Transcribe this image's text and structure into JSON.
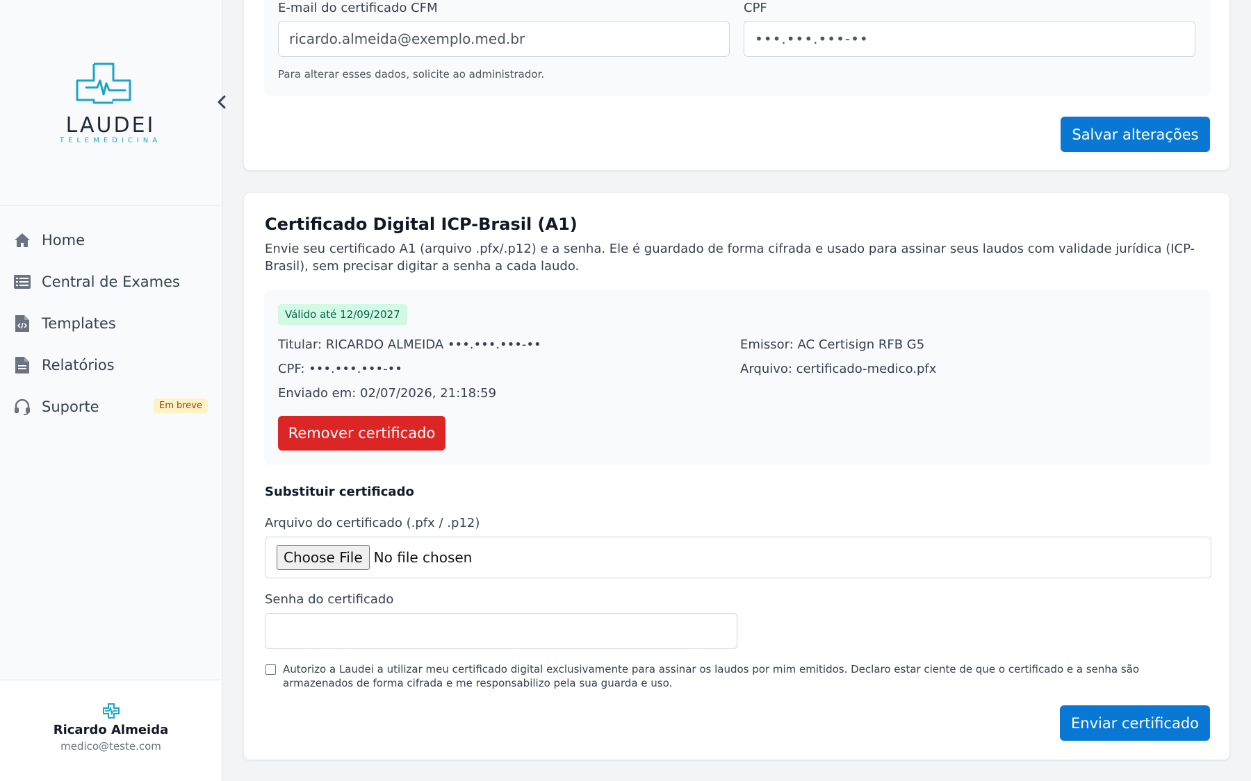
{
  "brand": {
    "name": "LAUDEI",
    "tagline": "TELEMEDICINA",
    "accent": "#1ba6c9"
  },
  "sidebar": {
    "items": [
      {
        "label": "Home",
        "icon": "home-icon"
      },
      {
        "label": "Central de Exames",
        "icon": "list-icon"
      },
      {
        "label": "Templates",
        "icon": "code-file-icon"
      },
      {
        "label": "Relatórios",
        "icon": "document-icon"
      },
      {
        "label": "Suporte",
        "icon": "headset-icon",
        "badge": "Em breve"
      }
    ]
  },
  "user": {
    "name": "Ricardo Almeida",
    "email": "medico@teste.com"
  },
  "profile": {
    "email_label": "E-mail do certificado CFM",
    "email_value": "ricardo.almeida@exemplo.med.br",
    "cpf_label": "CPF",
    "cpf_value": "•••.•••.•••-••",
    "hint": "Para alterar esses dados, solicite ao administrador.",
    "save_label": "Salvar alterações"
  },
  "certificate": {
    "title": "Certificado Digital ICP-Brasil (A1)",
    "description": "Envie seu certificado A1 (arquivo .pfx/.p12) e a senha. Ele é guardado de forma cifrada e usado para assinar seus laudos com validade jurídica (ICP-Brasil), sem precisar digitar a senha a cada laudo.",
    "valid_badge": "Válido até 12/09/2027",
    "holder": "Titular: RICARDO ALMEIDA •••.•••.•••-••",
    "cpf": "CPF: •••.•••.•••-••",
    "sent_at": "Enviado em: 02/07/2026, 21:18:59",
    "issuer": "Emissor: AC Certisign RFB G5",
    "file": "Arquivo: certificado-medico.pfx",
    "remove_label": "Remover certificado",
    "replace_title": "Substituir certificado",
    "file_label": "Arquivo do certificado (.pfx / .p12)",
    "choose_file": "Choose File",
    "no_file": "No file chosen",
    "password_label": "Senha do certificado",
    "password_value": "",
    "consent": "Autorizo a Laudei a utilizar meu certificado digital exclusivamente para assinar os laudos por mim emitidos. Declaro estar ciente de que o certificado e a senha são armazenados de forma cifrada e me responsabilizo pela sua guarda e uso.",
    "consent_checked": false,
    "submit_label": "Enviar certificado"
  },
  "colors": {
    "primary": "#0878d4",
    "danger": "#dc2626",
    "success_bg": "#d1fae5"
  }
}
